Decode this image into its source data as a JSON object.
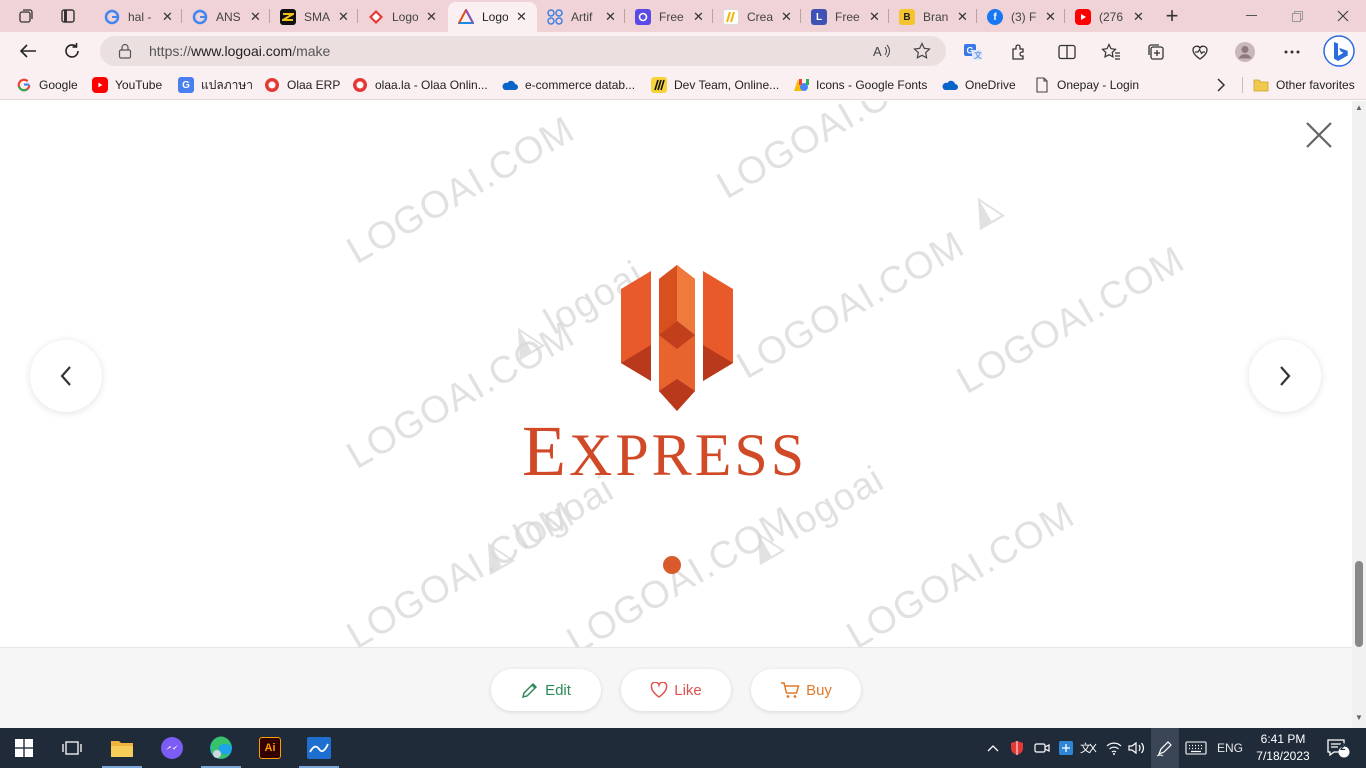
{
  "browser": {
    "tabs": [
      {
        "title": "hal -",
        "icon": "google-icon",
        "color": "#4285f4"
      },
      {
        "title": "ANS",
        "icon": "google-icon",
        "color": "#4285f4"
      },
      {
        "title": "SMA",
        "icon": "sma-icon",
        "color": "#f2c21b"
      },
      {
        "title": "Logo",
        "icon": "logo-diamond-icon",
        "color": "#e53935"
      },
      {
        "title": "Logo",
        "icon": "logoai-triangle-icon",
        "color": "#7e57c2",
        "active": true
      },
      {
        "title": "Artif",
        "icon": "artificial-icon",
        "color": "#3f7fe0"
      },
      {
        "title": "Free",
        "icon": "free-icon",
        "color": "#5b4be6"
      },
      {
        "title": "Crea",
        "icon": "create-icon",
        "color": "#f4b400"
      },
      {
        "title": "Free",
        "icon": "letter-l-icon",
        "color": "#3f51b5"
      },
      {
        "title": "Bran",
        "icon": "letter-b-icon",
        "color": "#f4c430"
      },
      {
        "title": "(3) F",
        "icon": "facebook-icon",
        "color": "#1877f2"
      },
      {
        "title": "(276",
        "icon": "youtube-icon",
        "color": "#ff0000"
      }
    ],
    "address": {
      "scheme": "https://",
      "host": "www.logoai.com",
      "path": "/make"
    },
    "bookmarks": [
      {
        "label": "Google",
        "icon": "google-icon",
        "color": "#4285f4"
      },
      {
        "label": "YouTube",
        "icon": "youtube-icon",
        "color": "#ff0000"
      },
      {
        "label": "แปลภาษา",
        "icon": "translate-icon",
        "color": "#4a7ff0"
      },
      {
        "label": "Olaa ERP",
        "icon": "olaa-icon",
        "color": "#e53935"
      },
      {
        "label": "olaa.la - Olaa Onlin...",
        "icon": "olaa-icon",
        "color": "#e53935"
      },
      {
        "label": "e-commerce datab...",
        "icon": "onedrive-icon",
        "color": "#0a64c8"
      },
      {
        "label": "Dev Team, Online...",
        "icon": "miro-icon",
        "color": "#111111"
      },
      {
        "label": "Icons - Google Fonts",
        "icon": "google-fonts-icon",
        "color": "#34a853"
      },
      {
        "label": "OneDrive",
        "icon": "onedrive-icon",
        "color": "#0a64c8"
      },
      {
        "label": "Onepay - Login",
        "icon": "page-icon",
        "color": "#555555"
      }
    ],
    "other_favorites": "Other favorites"
  },
  "page": {
    "watermark_text": "LOGOAI.COM",
    "watermark_brand": "logoai",
    "logo_text": "EXPRESS",
    "logo_color": "#d14a28",
    "actions": {
      "edit": "Edit",
      "like": "Like",
      "buy": "Buy"
    },
    "colors": {
      "edit": "#2e8b57",
      "like": "#e0524f",
      "buy": "#e07a2a"
    }
  },
  "taskbar": {
    "language": "ENG",
    "time": "6:41 PM",
    "date": "7/18/2023",
    "notifications": "2"
  }
}
